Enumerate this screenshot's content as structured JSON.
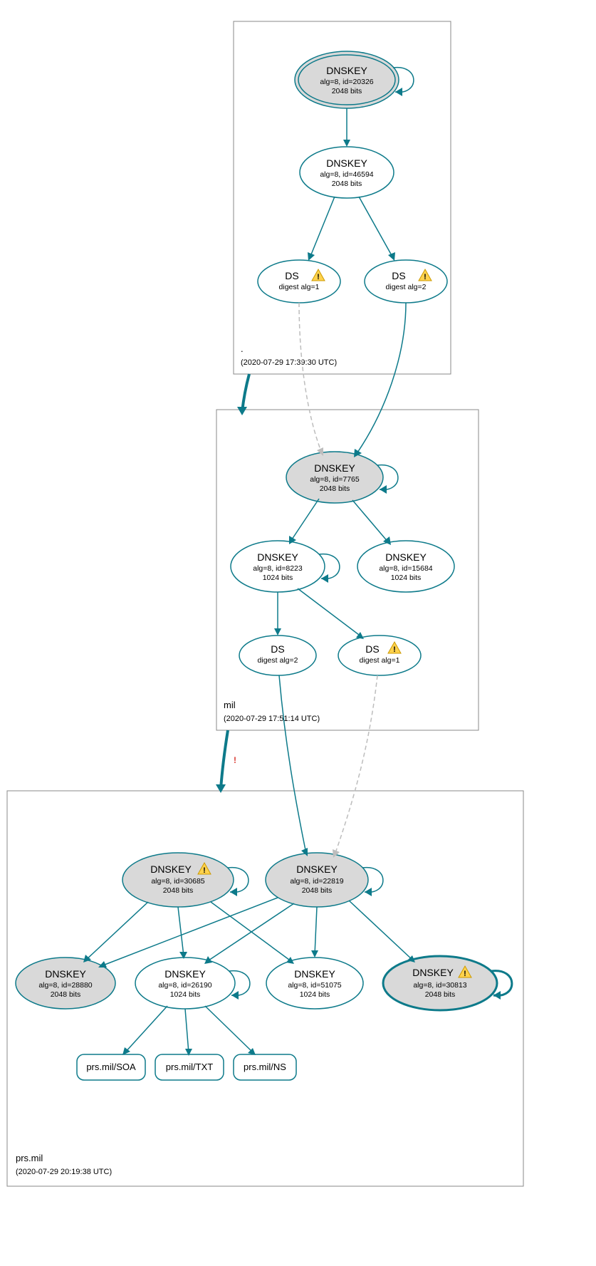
{
  "colors": {
    "stroke": "#0d7a8a",
    "node_fill_grey": "#d9d9d9",
    "dashed": "#bdbdbd",
    "warn_fill": "#ffd24d",
    "warn_stroke": "#cc9a00",
    "err_stroke": "#d93a32"
  },
  "zones": {
    "root": {
      "label": ".",
      "timestamp": "(2020-07-29 17:39:30 UTC)"
    },
    "mil": {
      "label": "mil",
      "timestamp": "(2020-07-29 17:51:14 UTC)"
    },
    "prsmil": {
      "label": "prs.mil",
      "timestamp": "(2020-07-29 20:19:38 UTC)"
    }
  },
  "nodes": {
    "root_ksk": {
      "title": "DNSKEY",
      "sub1": "alg=8, id=20326",
      "sub2": "2048 bits"
    },
    "root_zsk": {
      "title": "DNSKEY",
      "sub1": "alg=8, id=46594",
      "sub2": "2048 bits"
    },
    "root_ds1": {
      "title": "DS",
      "sub1": "digest alg=1"
    },
    "root_ds2": {
      "title": "DS",
      "sub1": "digest alg=2"
    },
    "mil_ksk": {
      "title": "DNSKEY",
      "sub1": "alg=8, id=7765",
      "sub2": "2048 bits"
    },
    "mil_zsk1": {
      "title": "DNSKEY",
      "sub1": "alg=8, id=8223",
      "sub2": "1024 bits"
    },
    "mil_zsk2": {
      "title": "DNSKEY",
      "sub1": "alg=8, id=15684",
      "sub2": "1024 bits"
    },
    "mil_ds2": {
      "title": "DS",
      "sub1": "digest alg=2"
    },
    "mil_ds1": {
      "title": "DS",
      "sub1": "digest alg=1"
    },
    "prs_ksk1": {
      "title": "DNSKEY",
      "sub1": "alg=8, id=30685",
      "sub2": "2048 bits"
    },
    "prs_ksk2": {
      "title": "DNSKEY",
      "sub1": "alg=8, id=22819",
      "sub2": "2048 bits"
    },
    "prs_k1": {
      "title": "DNSKEY",
      "sub1": "alg=8, id=28880",
      "sub2": "2048 bits"
    },
    "prs_k2": {
      "title": "DNSKEY",
      "sub1": "alg=8, id=26190",
      "sub2": "1024 bits"
    },
    "prs_k3": {
      "title": "DNSKEY",
      "sub1": "alg=8, id=51075",
      "sub2": "1024 bits"
    },
    "prs_k4": {
      "title": "DNSKEY",
      "sub1": "alg=8, id=30813",
      "sub2": "2048 bits"
    },
    "rr_soa": {
      "label": "prs.mil/SOA"
    },
    "rr_txt": {
      "label": "prs.mil/TXT"
    },
    "rr_ns": {
      "label": "prs.mil/NS"
    }
  }
}
